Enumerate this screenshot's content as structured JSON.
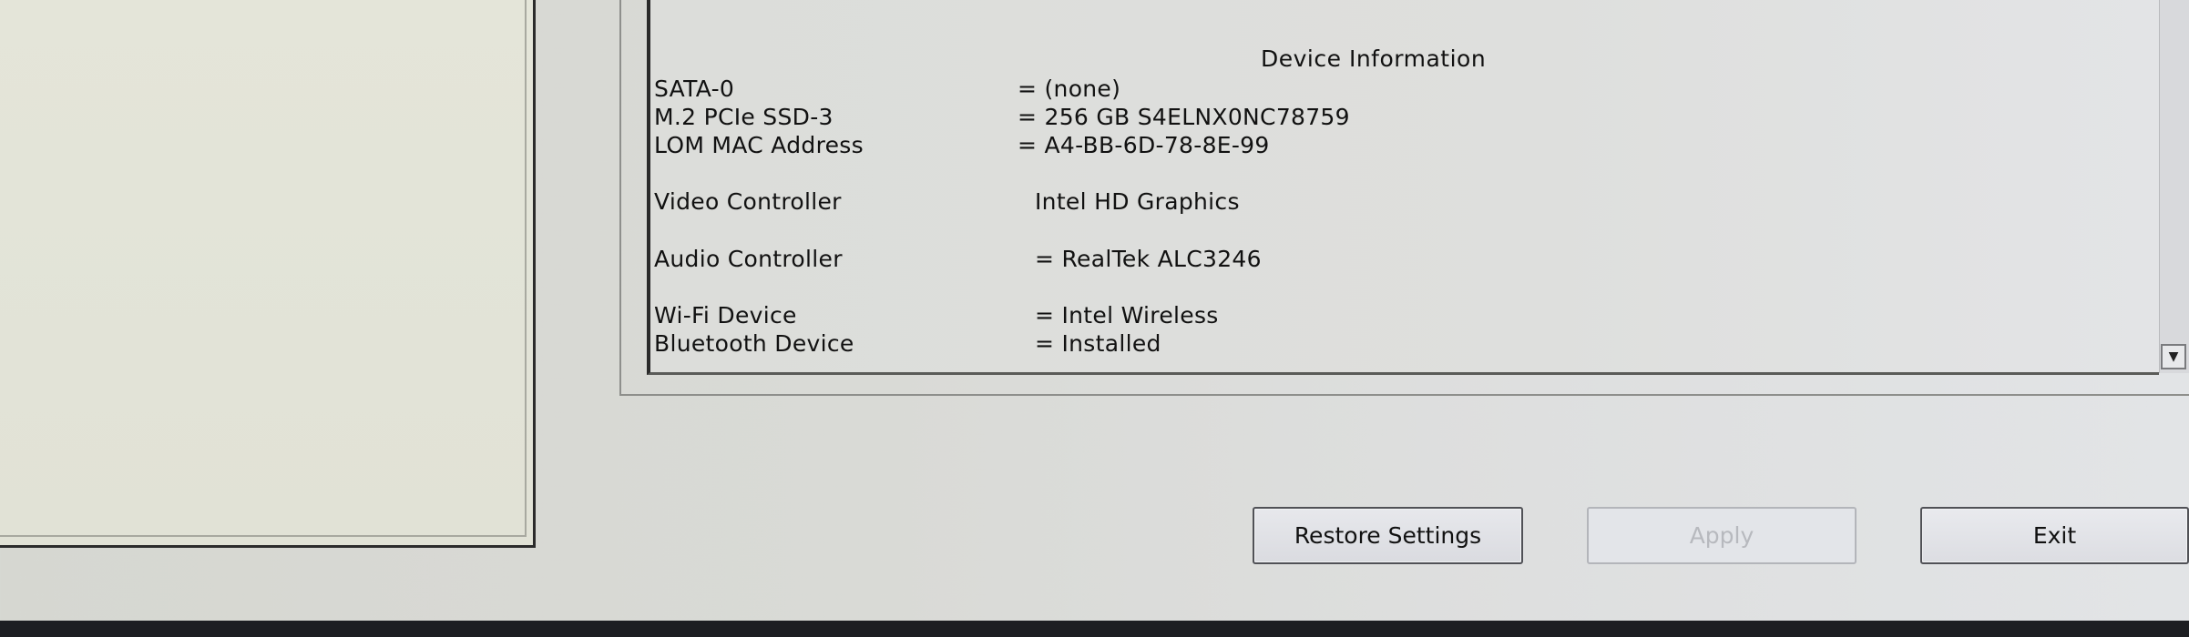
{
  "device_info": {
    "title": "Device Information",
    "rows": [
      {
        "label": "SATA-0",
        "value": "= (none)"
      },
      {
        "label": "M.2 PCIe SSD-3",
        "value": "= 256 GB S4ELNX0NC78759"
      },
      {
        "label": "LOM MAC Address",
        "value": "= A4-BB-6D-78-8E-99"
      },
      {
        "label": "Video Controller",
        "value": "Intel HD Graphics"
      },
      {
        "label": "Audio Controller",
        "value": "= RealTek ALC3246"
      },
      {
        "label": "Wi-Fi Device",
        "value": "= Intel Wireless"
      },
      {
        "label": "Bluetooth Device",
        "value": "= Installed"
      }
    ]
  },
  "buttons": {
    "restore": "Restore Settings",
    "apply": "Apply",
    "exit": "Exit"
  },
  "icons": {
    "scroll_down": "scroll-down-arrow-icon"
  },
  "colors": {
    "panel_background": "#dedfdd",
    "left_panel_background": "#e3e4d8",
    "button_border": "#505156",
    "disabled_text": "#b7b9be"
  }
}
